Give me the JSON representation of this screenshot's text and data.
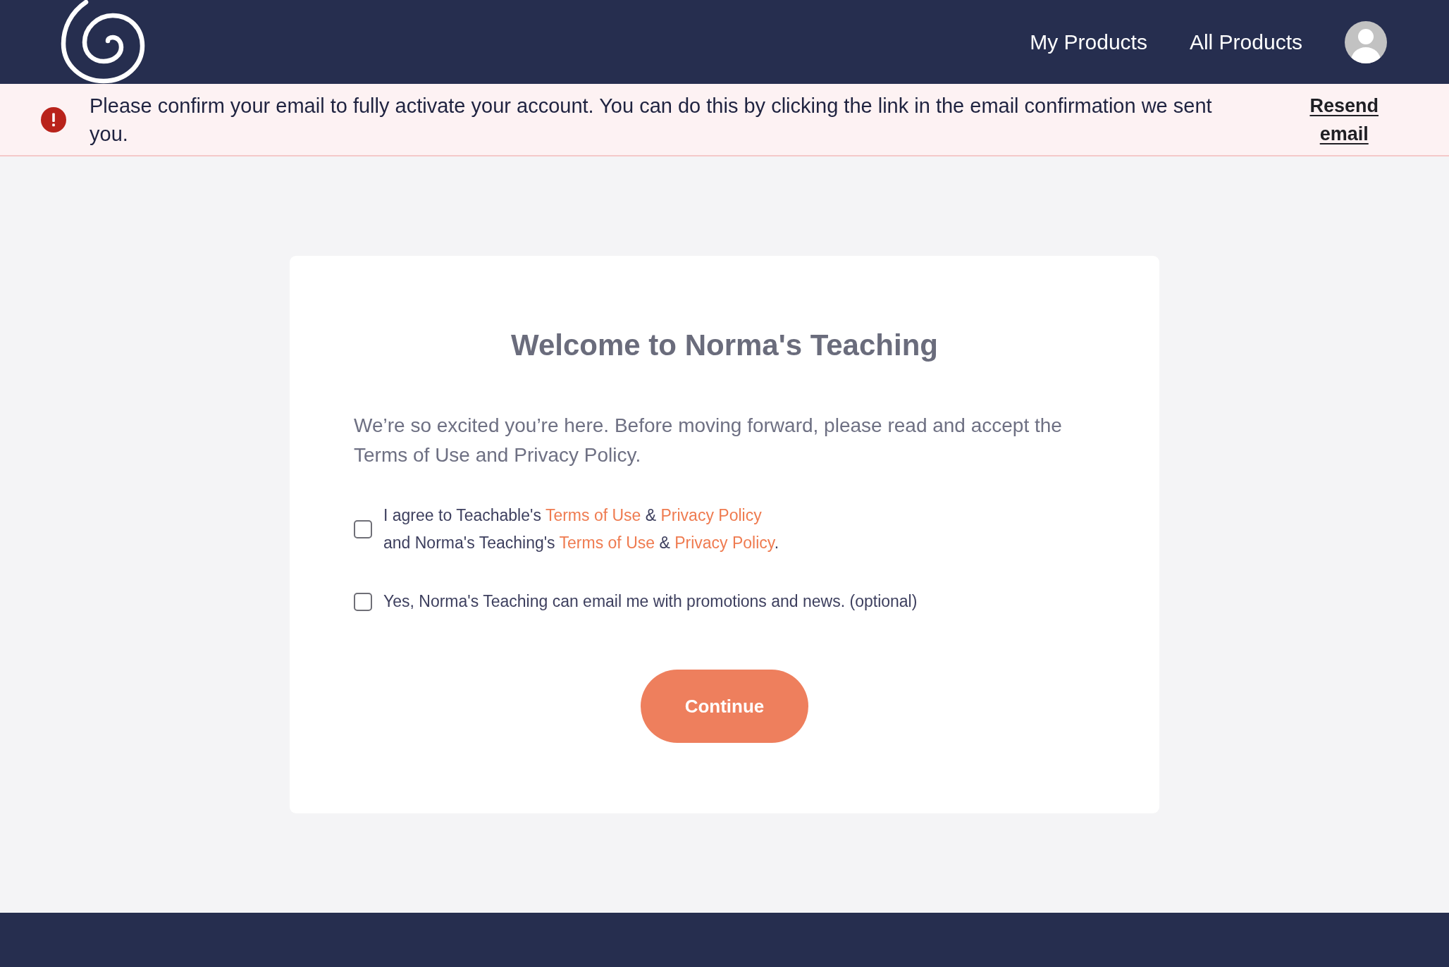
{
  "header": {
    "nav": [
      "My Products",
      "All Products"
    ]
  },
  "alert": {
    "message": "Please confirm your email to fully activate your account. You can do this by clicking the link in the email confirmation we sent you.",
    "action": "Resend email"
  },
  "card": {
    "title": "Welcome to Norma's Teaching",
    "intro": "We’re so excited you’re here. Before moving forward, please read and accept the Terms of Use and Privacy Policy.",
    "agreements": [
      {
        "checked": false,
        "lines": [
          [
            {
              "kind": "text",
              "text": "I agree to Teachable's "
            },
            {
              "kind": "link",
              "text": "Terms of Use"
            },
            {
              "kind": "text",
              "text": " & "
            },
            {
              "kind": "link",
              "text": "Privacy Policy"
            }
          ],
          [
            {
              "kind": "text",
              "text": "and Norma's Teaching's "
            },
            {
              "kind": "link",
              "text": "Terms of Use"
            },
            {
              "kind": "text",
              "text": " & "
            },
            {
              "kind": "link",
              "text": "Privacy Policy"
            },
            {
              "kind": "text",
              "text": "."
            }
          ]
        ]
      },
      {
        "checked": false,
        "lines": [
          [
            {
              "kind": "text",
              "text": "Yes, Norma's Teaching can email me with promotions and news. (optional)"
            }
          ]
        ]
      }
    ],
    "button": "Continue"
  }
}
